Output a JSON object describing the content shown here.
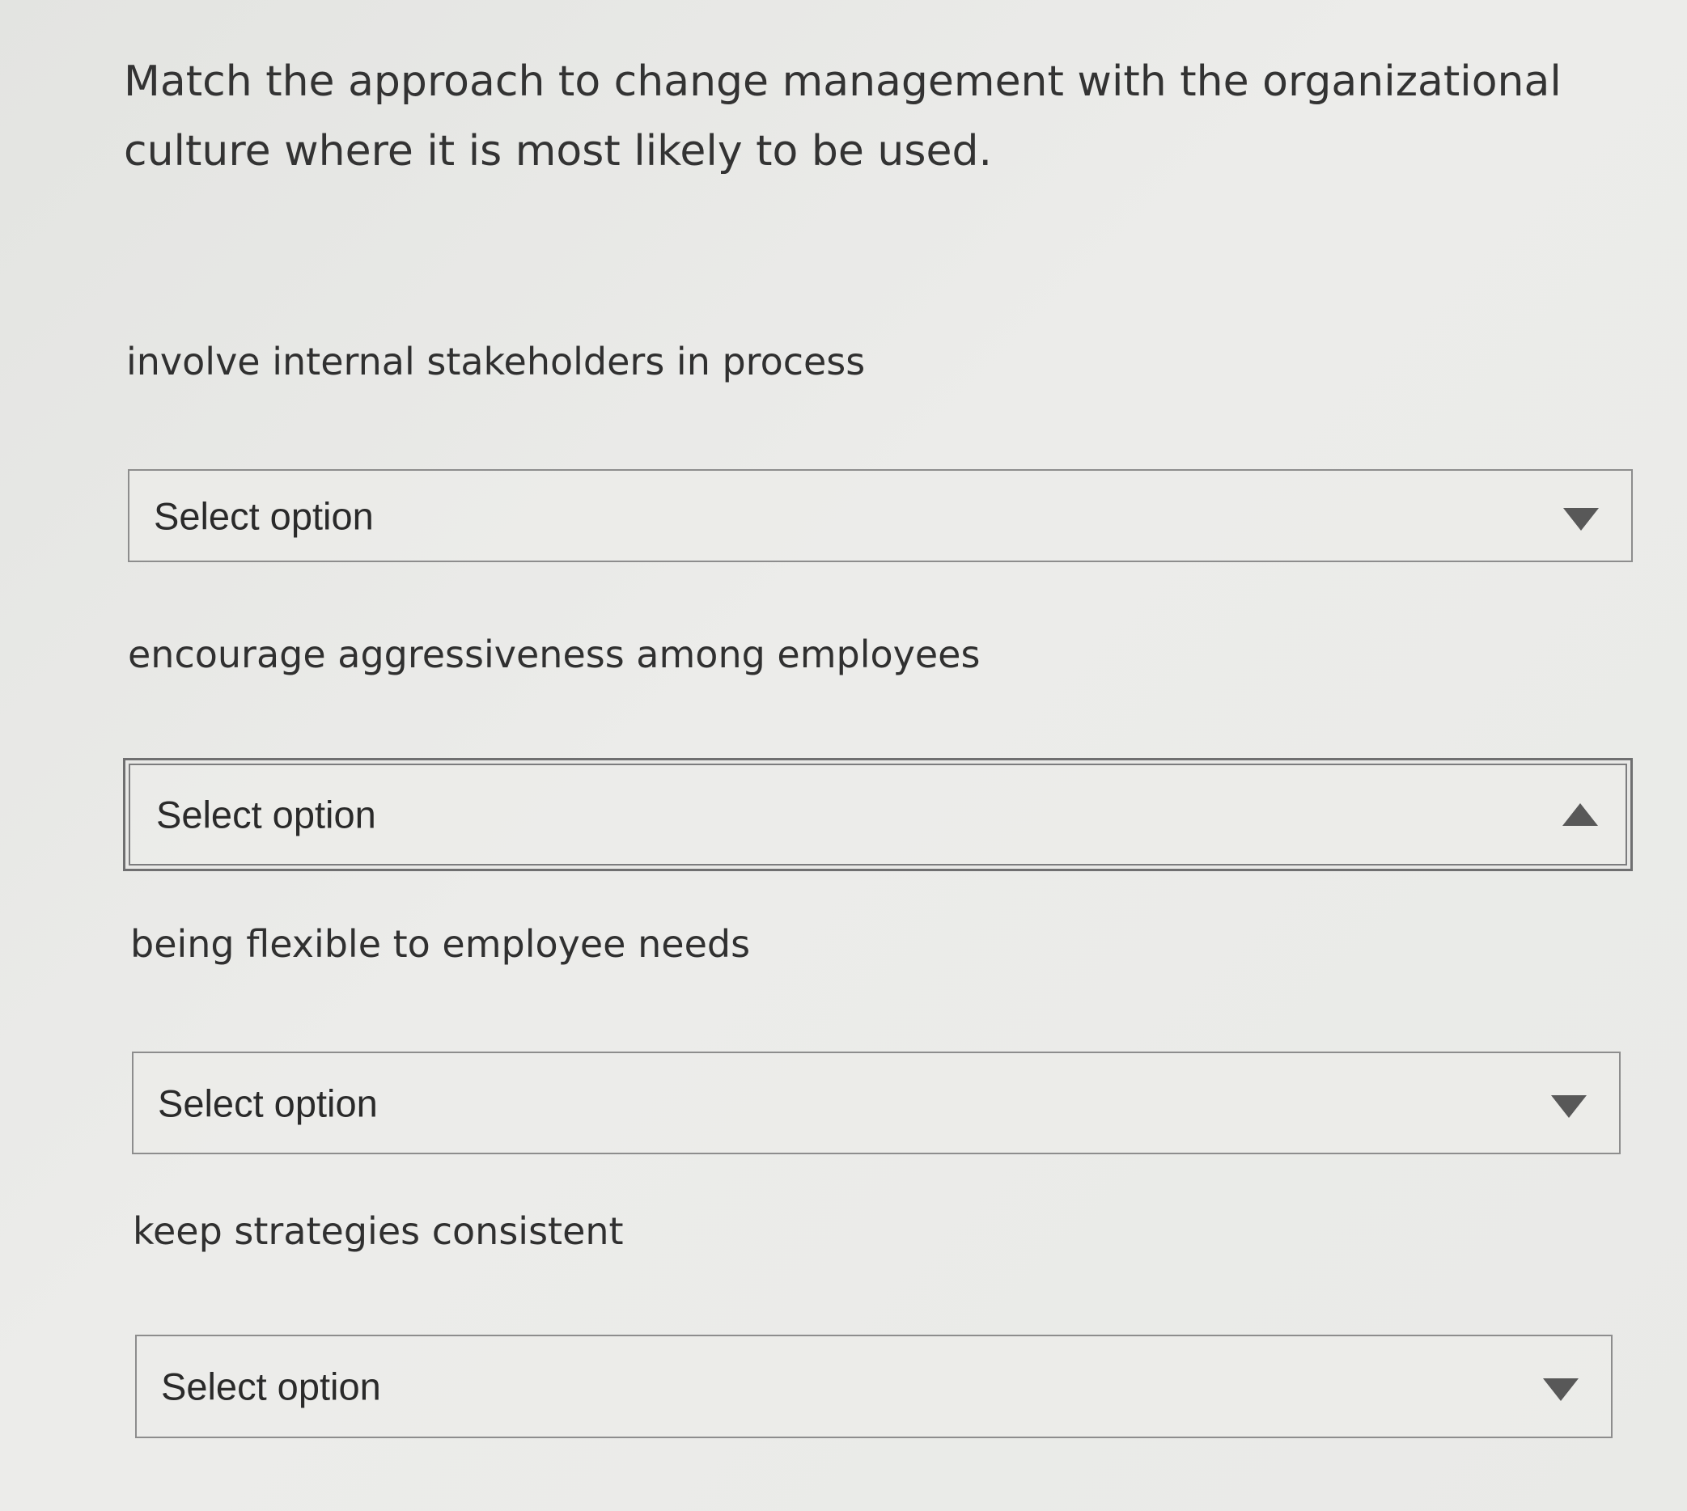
{
  "question": {
    "text": "Match the approach to change management with the organizational culture where it is most likely to be used."
  },
  "items": [
    {
      "prompt": "involve internal stakeholders in process",
      "select": {
        "value": "Select option",
        "icon": "caret-down-icon",
        "state": "closed"
      }
    },
    {
      "prompt": "encourage aggressiveness among employees",
      "select": {
        "value": "Select option",
        "icon": "caret-up-icon",
        "state": "open"
      }
    },
    {
      "prompt": "being flexible to employee needs",
      "select": {
        "value": "Select option",
        "icon": "caret-down-icon",
        "state": "closed"
      }
    },
    {
      "prompt": "keep strategies consistent",
      "select": {
        "value": "Select option",
        "icon": "caret-down-icon",
        "state": "closed"
      }
    }
  ]
}
